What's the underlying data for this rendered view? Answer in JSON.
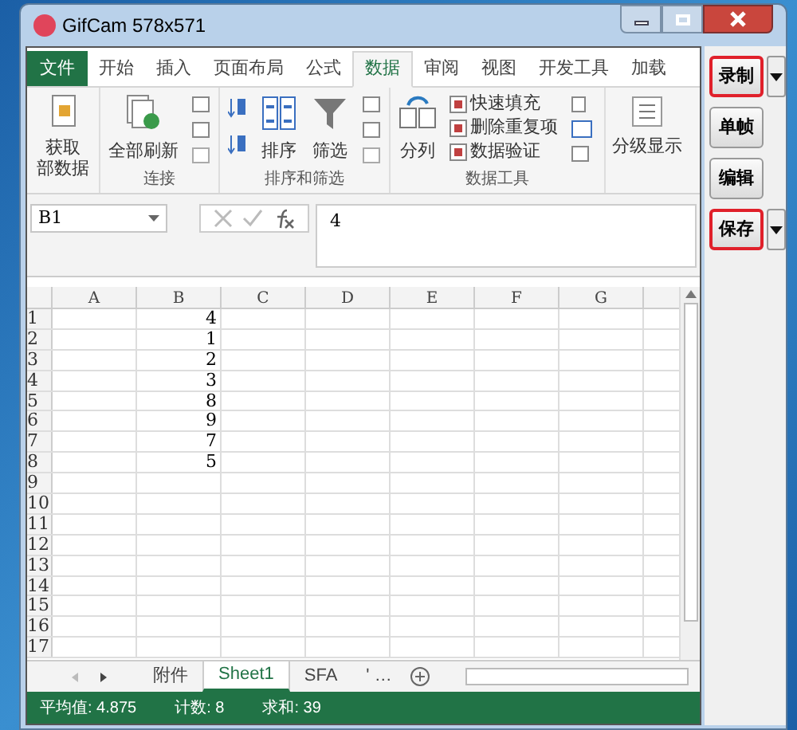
{
  "window": {
    "title": "GifCam 578x571"
  },
  "ribbon_tabs": [
    {
      "label": "文件",
      "kind": "file",
      "selected": false
    },
    {
      "label": "开始",
      "kind": "tab",
      "selected": false
    },
    {
      "label": "插入",
      "kind": "tab",
      "selected": false
    },
    {
      "label": "页面布局",
      "kind": "tab",
      "selected": false
    },
    {
      "label": "公式",
      "kind": "tab",
      "selected": false
    },
    {
      "label": "数据",
      "kind": "tab",
      "selected": true
    },
    {
      "label": "审阅",
      "kind": "tab",
      "selected": false
    },
    {
      "label": "视图",
      "kind": "tab",
      "selected": false
    },
    {
      "label": "开发工具",
      "kind": "tab",
      "selected": false
    },
    {
      "label": "加载",
      "kind": "tab",
      "selected": false
    }
  ],
  "ribbon": {
    "get_data": {
      "lines": [
        "获取",
        "部数据"
      ]
    },
    "groups": [
      {
        "label": "连接",
        "big": [
          "全部刷新"
        ]
      },
      {
        "label": "排序和筛选",
        "big": [
          "排序",
          "筛选"
        ]
      },
      {
        "label": "数据工具",
        "big": [
          "分列"
        ],
        "small": [
          "快速填充",
          "删除重复项",
          "数据验证"
        ]
      }
    ],
    "outline": {
      "label": "分级显示"
    }
  },
  "formula_bar": {
    "name_box": "B1",
    "value": "4"
  },
  "sheet": {
    "columns": [
      "A",
      "B",
      "C",
      "D",
      "E",
      "F",
      "G"
    ],
    "rows": [
      {
        "number": "1",
        "b": "4"
      },
      {
        "number": "2",
        "b": "1"
      },
      {
        "number": "3",
        "b": "2"
      },
      {
        "number": "4",
        "b": "3"
      },
      {
        "number": "5",
        "b": "8"
      },
      {
        "number": "6",
        "b": "9"
      },
      {
        "number": "7",
        "b": "7"
      },
      {
        "number": "8",
        "b": "5"
      },
      {
        "number": "9"
      },
      {
        "number": "10"
      },
      {
        "number": "11"
      },
      {
        "number": "12"
      },
      {
        "number": "13"
      },
      {
        "number": "14"
      },
      {
        "number": "15"
      },
      {
        "number": "16"
      },
      {
        "number": "17"
      }
    ]
  },
  "sheet_tabs": [
    {
      "label": "附件",
      "selected": false
    },
    {
      "label": "Sheet1",
      "selected": true
    },
    {
      "label": "SFA",
      "selected": false
    },
    {
      "label": "' …",
      "selected": false
    }
  ],
  "status_bar": [
    "平均值: 4.875",
    "计数: 8",
    "求和: 39"
  ],
  "gifcam_buttons": [
    {
      "label": "录制",
      "dropdown": true,
      "highlighted": true
    },
    {
      "label": "单帧",
      "dropdown": false,
      "highlighted": false
    },
    {
      "label": "编辑",
      "dropdown": false,
      "highlighted": false
    },
    {
      "label": "保存",
      "dropdown": true,
      "highlighted": true
    }
  ]
}
